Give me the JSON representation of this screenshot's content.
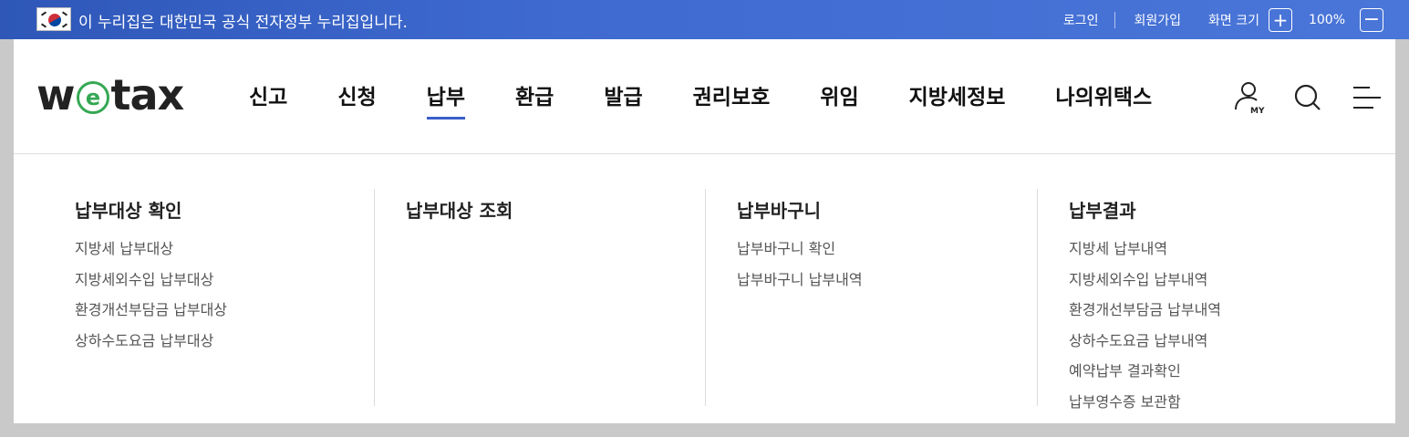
{
  "gov_banner": {
    "text": "이 누리집은 대한민국 공식 전자정부 누리집입니다.",
    "login": "로그인",
    "signup": "회원가입",
    "screen_size_label": "화면 크기",
    "zoom_in": "+",
    "zoom_level": "100%",
    "zoom_out": "−"
  },
  "logo": {
    "prefix": "w",
    "e": "e",
    "suffix": "tax"
  },
  "nav": {
    "items": [
      {
        "label": "신고"
      },
      {
        "label": "신청"
      },
      {
        "label": "납부",
        "active": true
      },
      {
        "label": "환급"
      },
      {
        "label": "발급"
      },
      {
        "label": "권리보호"
      },
      {
        "label": "위임"
      },
      {
        "label": "지방세정보"
      },
      {
        "label": "나의위택스"
      }
    ],
    "my_label": "MY"
  },
  "mega_menu": {
    "columns": [
      {
        "title": "납부대상 확인",
        "links": [
          "지방세 납부대상",
          "지방세외수입 납부대상",
          "환경개선부담금 납부대상",
          "상하수도요금 납부대상"
        ]
      },
      {
        "title": "납부대상 조회",
        "links": []
      },
      {
        "title": "납부바구니",
        "links": [
          "납부바구니 확인",
          "납부바구니 납부내역"
        ]
      },
      {
        "title": "납부결과",
        "links": [
          "지방세 납부내역",
          "지방세외수입 납부내역",
          "환경개선부담금 납부내역",
          "상하수도요금 납부내역",
          "예약납부 결과확인",
          "납부영수증 보관함"
        ]
      }
    ]
  },
  "colors": {
    "banner": "#3f6ad0",
    "accent": "#3a5fc9",
    "logo_green": "#35a854"
  }
}
